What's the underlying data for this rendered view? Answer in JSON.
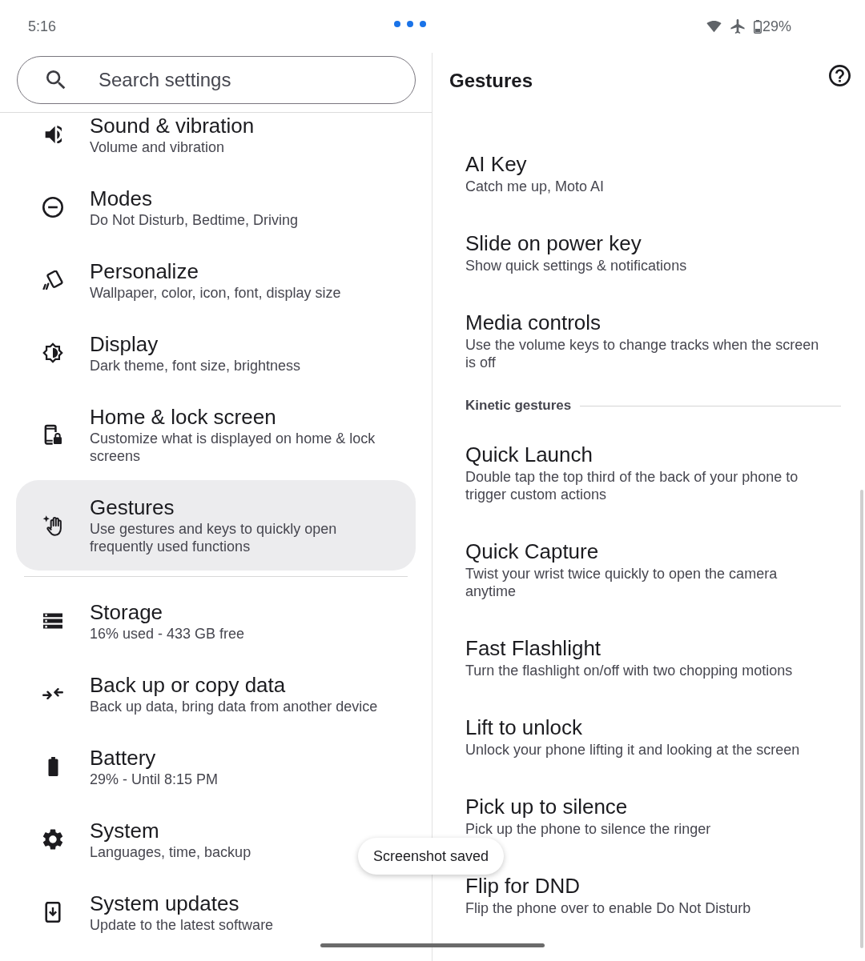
{
  "status_bar": {
    "time": "5:16",
    "battery": "29%"
  },
  "search": {
    "placeholder": "Search settings"
  },
  "settings_groups": [
    {
      "items": [
        {
          "title": "Sound & vibration",
          "subtitle": "Volume and vibration",
          "selected": false
        },
        {
          "title": "Modes",
          "subtitle": "Do Not Disturb, Bedtime, Driving",
          "selected": false
        },
        {
          "title": "Personalize",
          "subtitle": "Wallpaper, color, icon, font, display size",
          "selected": false
        },
        {
          "title": "Display",
          "subtitle": "Dark theme, font size, brightness",
          "selected": false
        },
        {
          "title": "Home & lock screen",
          "subtitle": "Customize what is displayed on home & lock screens",
          "selected": false
        },
        {
          "title": "Gestures",
          "subtitle": "Use gestures and keys to quickly open frequently used functions",
          "selected": true
        }
      ]
    },
    {
      "items": [
        {
          "title": "Storage",
          "subtitle": "16% used - 433 GB free",
          "selected": false
        },
        {
          "title": "Back up or copy data",
          "subtitle": "Back up data, bring data from another device",
          "selected": false
        },
        {
          "title": "Battery",
          "subtitle": "29% - Until 8:15 PM",
          "selected": false
        },
        {
          "title": "System",
          "subtitle": "Languages, time, backup",
          "selected": false
        },
        {
          "title": "System updates",
          "subtitle": "Update to the latest software",
          "selected": false
        }
      ]
    }
  ],
  "detail": {
    "title": "Gestures",
    "sections": [
      {
        "items": [
          {
            "title": "AI Key",
            "subtitle": "Catch me up, Moto AI"
          },
          {
            "title": "Slide on power key",
            "subtitle": "Show quick settings & notifications"
          },
          {
            "title": "Media controls",
            "subtitle": "Use the volume keys to change tracks when the screen is off"
          }
        ]
      },
      {
        "header": "Kinetic gestures",
        "items": [
          {
            "title": "Quick Launch",
            "subtitle": "Double tap the top third of the back of your phone to trigger custom actions"
          },
          {
            "title": "Quick Capture",
            "subtitle": "Twist your wrist twice quickly to open the camera anytime"
          },
          {
            "title": "Fast Flashlight",
            "subtitle": "Turn the flashlight on/off with two chopping motions"
          },
          {
            "title": "Lift to unlock",
            "subtitle": "Unlock your phone lifting it and looking at the screen"
          },
          {
            "title": "Pick up to silence",
            "subtitle": "Pick up the phone to silence the ringer"
          },
          {
            "title": "Flip for DND",
            "subtitle": "Flip the phone over to enable Do Not Disturb"
          }
        ]
      }
    ]
  },
  "toast": {
    "text": "Screenshot saved"
  }
}
